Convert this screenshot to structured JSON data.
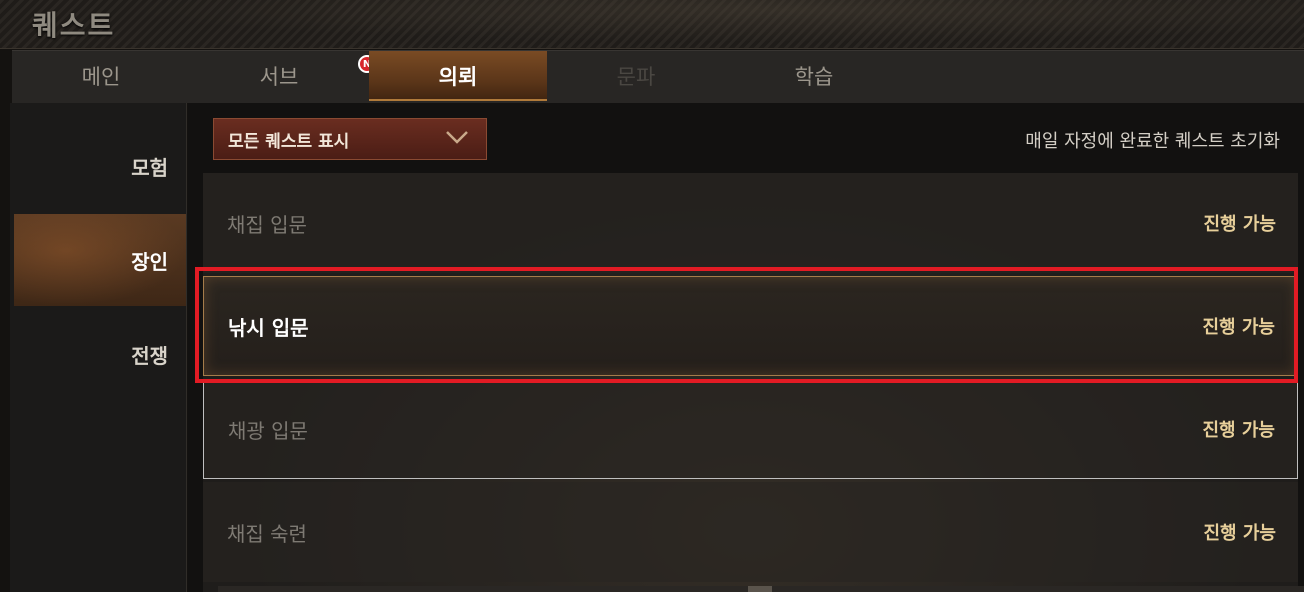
{
  "window": {
    "title": "퀘스트"
  },
  "tabs": [
    {
      "label": "메인",
      "state": "normal"
    },
    {
      "label": "서브",
      "state": "normal",
      "badge": "N"
    },
    {
      "label": "의뢰",
      "state": "active"
    },
    {
      "label": "문파",
      "state": "disabled"
    },
    {
      "label": "학습",
      "state": "normal"
    }
  ],
  "categories": [
    {
      "label": "모험",
      "active": false
    },
    {
      "label": "장인",
      "active": true
    },
    {
      "label": "전쟁",
      "active": false
    }
  ],
  "filter": {
    "selected": "모든 퀘스트 표시"
  },
  "reset_note": "매일 자정에 완료한 퀘스트 초기화",
  "quests": [
    {
      "name": "채집 입문",
      "status": "진행 가능"
    },
    {
      "name": "낚시 입문",
      "status": "진행 가능",
      "selected": true
    },
    {
      "name": "채광 입문",
      "status": "진행 가능"
    },
    {
      "name": "채집 숙련",
      "status": "진행 가능"
    }
  ],
  "colors": {
    "accent": "#7a4b24",
    "status": "#e7cf9a",
    "highlight": "#e21b24",
    "badge": "#d7262b"
  },
  "icons": {
    "dropdown": "chevron-down-icon",
    "badge": "new-badge-icon"
  }
}
